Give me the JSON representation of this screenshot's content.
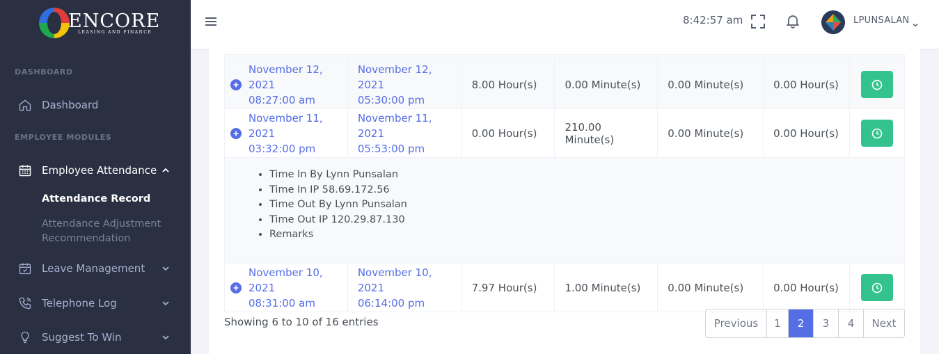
{
  "brand": {
    "name": "ENCORE",
    "tagline": "LEASING AND FINANCE"
  },
  "sidebar": {
    "section_dashboard": "DASHBOARD",
    "dashboard": "Dashboard",
    "section_employee": "EMPLOYEE MODULES",
    "employee_attendance": "Employee Attendance",
    "attendance_record": "Attendance Record",
    "attendance_adjustment_1": "Attendance Adjustment",
    "attendance_adjustment_2": "Recommendation",
    "leave_management": "Leave Management",
    "telephone_log": "Telephone Log",
    "suggest_to_win": "Suggest To Win"
  },
  "topbar": {
    "time": "8:42:57 am",
    "username": "LPUNSALAN"
  },
  "rows": [
    {
      "in_date": "November 12, 2021",
      "in_time": "08:27:00 am",
      "out_date": "November 12, 2021",
      "out_time": "05:30:00 pm",
      "hours": "8.00 Hour(s)",
      "late": "0.00 Minute(s)",
      "undertime": "0.00 Minute(s)",
      "overtime": "0.00 Hour(s)"
    },
    {
      "in_date": "November 11, 2021",
      "in_time": "03:32:00 pm",
      "out_date": "November 11, 2021",
      "out_time": "05:53:00 pm",
      "hours": "0.00 Hour(s)",
      "late": "210.00 Minute(s)",
      "undertime": "0.00 Minute(s)",
      "overtime": "0.00 Hour(s)"
    },
    {
      "in_date": "November 10, 2021",
      "in_time": "08:31:00 am",
      "out_date": "November 10, 2021",
      "out_time": "06:14:00 pm",
      "hours": "7.97 Hour(s)",
      "late": "1.00 Minute(s)",
      "undertime": "0.00 Minute(s)",
      "overtime": "0.00 Hour(s)"
    }
  ],
  "detail": [
    "Time In By Lynn Punsalan",
    "Time In IP 58.69.172.56",
    "Time Out By Lynn Punsalan",
    "Time Out IP 120.29.87.130",
    "Remarks"
  ],
  "footer": {
    "showing": "Showing 6 to 10 of 16 entries"
  },
  "pagination": {
    "previous": "Previous",
    "p1": "1",
    "p2": "2",
    "p3": "3",
    "p4": "4",
    "next": "Next",
    "active": "2"
  },
  "colors": {
    "sidebar": "#2a3042",
    "primary": "#556ee6",
    "success": "#34c38f"
  }
}
